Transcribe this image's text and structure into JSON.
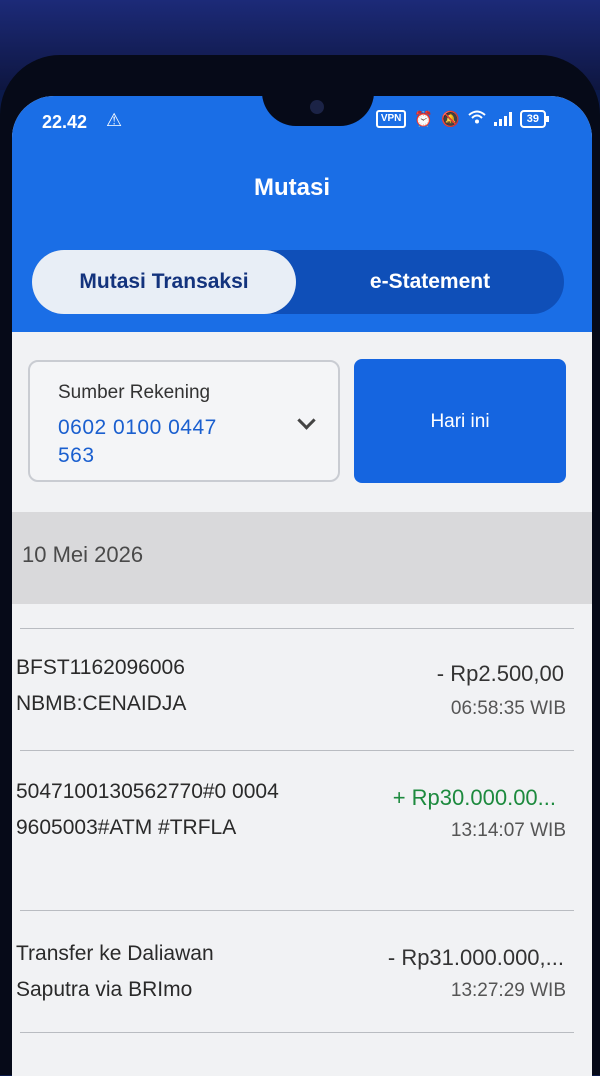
{
  "status_bar": {
    "time": "22.42",
    "vpn": "VPN",
    "battery": "39",
    "warn_icon": "warning-icon",
    "icons": [
      "alarm-icon",
      "mute-icon",
      "wifi-icon",
      "signal-icon"
    ]
  },
  "header": {
    "title": "Mutasi",
    "tabs": [
      {
        "label": "Mutasi Transaksi",
        "active": true
      },
      {
        "label": "e-Statement",
        "active": false
      }
    ],
    "color": "#1a6ee6"
  },
  "account": {
    "label": "Sumber Rekening",
    "number": "0602 0100 0447 563",
    "dropdown_icon": "chevron-down-icon"
  },
  "period_button": {
    "label": "Hari ini"
  },
  "date_header": "10 Mei 2026",
  "transactions": [
    {
      "description": "BFST1162096006 NBMB:CENAIDJA",
      "amount": "- Rp2.500,00",
      "time": "06:58:35 WIB",
      "type": "debit"
    },
    {
      "description": "5047100130562770#0 00049605003#ATM #TRFLA",
      "amount": "+ Rp30.000.00...",
      "time": "13:14:07 WIB",
      "type": "credit"
    },
    {
      "description": "Transfer ke Daliawan Saputra via BRImo",
      "amount": "- Rp31.000.000,...",
      "time": "13:27:29 WIB",
      "type": "debit"
    }
  ],
  "colors": {
    "credit": "#1d8a3e",
    "debit": "#333333",
    "account_number": "#1a5fcf",
    "button": "#1565e0"
  }
}
